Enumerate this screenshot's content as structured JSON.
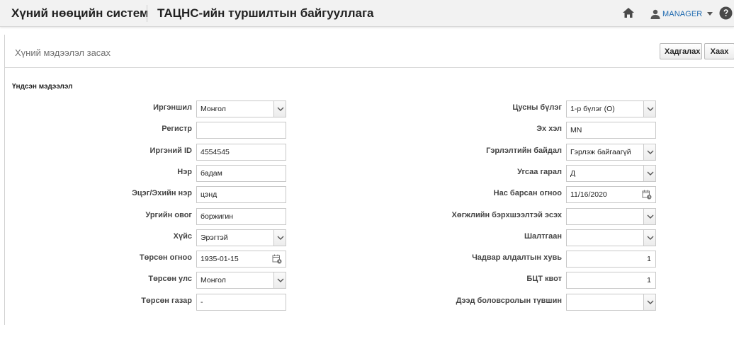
{
  "header": {
    "app_title": "Хүний нөөцийн систем",
    "org_title": "ТАЦНС-ийн туршилтын байгууллага",
    "user": "MANAGER",
    "icons": [
      "home-icon",
      "user-icon",
      "chevron-down-icon",
      "help-icon"
    ]
  },
  "panel": {
    "title": "Хүний мэдээлэл засах",
    "save_label": "Хадгалах",
    "close_label": "Хаах",
    "section_title": "Үндсэн мэдээлэл"
  },
  "left_fields": [
    {
      "label": "Иргэншил",
      "value": "Монгол",
      "type": "select"
    },
    {
      "label": "Регистр",
      "value": "",
      "type": "text"
    },
    {
      "label": "Иргэний ID",
      "value": "4554545",
      "type": "text"
    },
    {
      "label": "Нэр",
      "value": "бадам",
      "type": "text"
    },
    {
      "label": "Эцэг/Эхийн нэр",
      "value": "цэнд",
      "type": "text"
    },
    {
      "label": "Ургийн овог",
      "value": "боржигин",
      "type": "text"
    },
    {
      "label": "Хүйс",
      "value": "Эрэгтэй",
      "type": "select"
    },
    {
      "label": "Төрсөн огноо",
      "value": "1935-01-15",
      "type": "date"
    },
    {
      "label": "Төрсөн улс",
      "value": "Монгол",
      "type": "select"
    },
    {
      "label": "Төрсөн газар",
      "value": "-",
      "type": "text"
    }
  ],
  "right_fields": [
    {
      "label": "Цусны бүлэг",
      "value": "1-р бүлэг (O)",
      "type": "select"
    },
    {
      "label": "Эх хэл",
      "value": "MN",
      "type": "text"
    },
    {
      "label": "Гэрлэлтийн байдал",
      "value": "Гэрлэж байгаагүй",
      "type": "select"
    },
    {
      "label": "Угсаа гарал",
      "value": "Д",
      "type": "select"
    },
    {
      "label": "Нас барсан огноо",
      "value": "11/16/2020",
      "type": "date"
    },
    {
      "label": "Хөгжлийн бэрхшээлтэй эсэх",
      "value": "",
      "type": "select"
    },
    {
      "label": "Шалтгаан",
      "value": "",
      "type": "select"
    },
    {
      "label": "Чадвар алдалтын хувь",
      "value": "1",
      "type": "number"
    },
    {
      "label": "БЦТ квот",
      "value": "1",
      "type": "number"
    },
    {
      "label": "Дээд боловсролын түвшин",
      "value": "",
      "type": "select"
    }
  ],
  "colors": {
    "header_bg": "#f2f2f2",
    "user_link": "#1e6ab0",
    "border": "#c8c8c8"
  }
}
